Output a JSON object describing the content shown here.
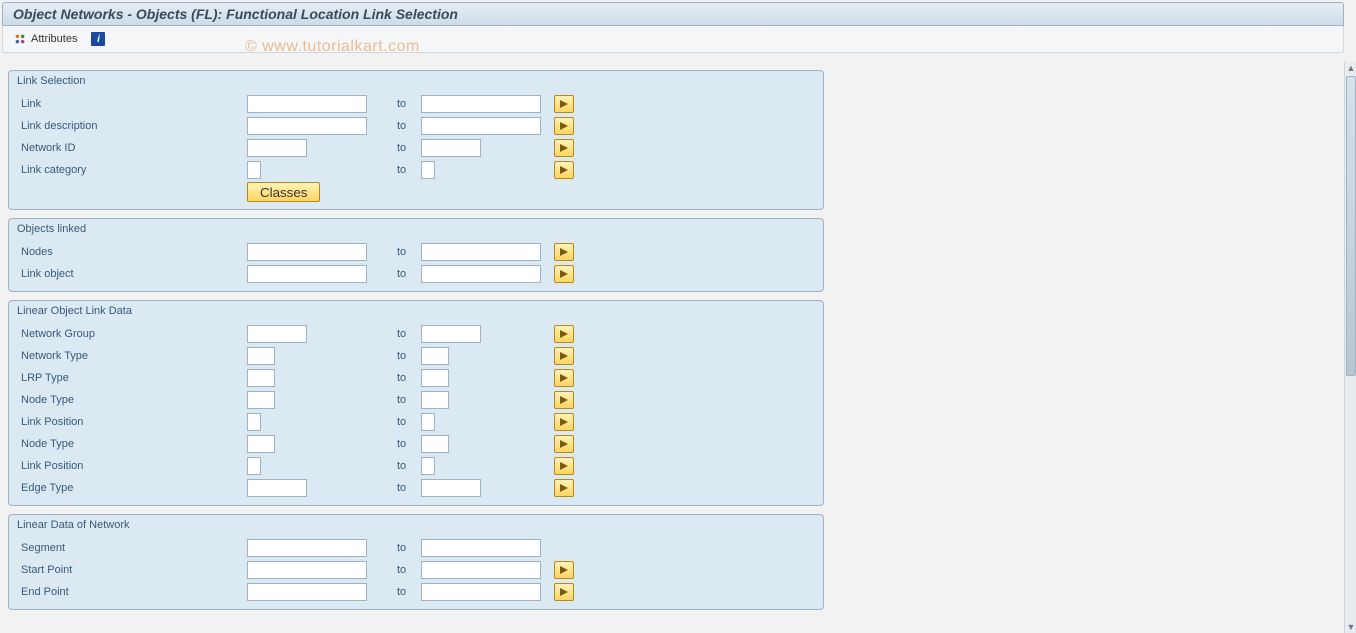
{
  "title": "Object Networks - Objects (FL): Functional Location Link Selection",
  "watermark": "© www.tutorialkart.com",
  "toolbar": {
    "attributes_label": "Attributes"
  },
  "common": {
    "to": "to"
  },
  "buttons": {
    "classes": "Classes"
  },
  "groups": {
    "link_selection": {
      "title": "Link Selection",
      "rows": {
        "link": {
          "label": "Link",
          "from_w": "w-lg",
          "to_w": "w-lg",
          "multi": true,
          "from": "",
          "to": ""
        },
        "link_desc": {
          "label": "Link description",
          "from_w": "w-lg",
          "to_w": "w-lg",
          "multi": true,
          "from": "",
          "to": ""
        },
        "network_id": {
          "label": "Network ID",
          "from_w": "w-md",
          "to_w": "w-md",
          "multi": true,
          "from": "",
          "to": ""
        },
        "link_category": {
          "label": "Link category",
          "from_w": "w-xs",
          "to_w": "w-xs",
          "multi": true,
          "from": "",
          "to": ""
        }
      }
    },
    "objects_linked": {
      "title": "Objects linked",
      "rows": {
        "nodes": {
          "label": "Nodes",
          "from_w": "w-lg",
          "to_w": "w-lg",
          "multi": true,
          "from": "",
          "to": ""
        },
        "link_object": {
          "label": "Link object",
          "from_w": "w-lg",
          "to_w": "w-lg",
          "multi": true,
          "from": "",
          "to": ""
        }
      }
    },
    "lold": {
      "title": "Linear Object Link Data",
      "rows": {
        "network_group": {
          "label": "Network Group",
          "from_w": "w-md",
          "to_w": "w-md",
          "multi": true,
          "from": "",
          "to": ""
        },
        "network_type": {
          "label": "Network Type",
          "from_w": "w-sm",
          "to_w": "w-sm",
          "multi": true,
          "from": "",
          "to": ""
        },
        "lrp_type": {
          "label": "LRP Type",
          "from_w": "w-sm",
          "to_w": "w-sm",
          "multi": true,
          "from": "",
          "to": ""
        },
        "node_type": {
          "label": "Node Type",
          "from_w": "w-sm",
          "to_w": "w-sm",
          "multi": true,
          "from": "",
          "to": ""
        },
        "link_position": {
          "label": "Link Position",
          "from_w": "w-xs",
          "to_w": "w-xs",
          "multi": true,
          "from": "",
          "to": ""
        },
        "node_type2": {
          "label": "Node Type",
          "from_w": "w-sm",
          "to_w": "w-sm",
          "multi": true,
          "from": "",
          "to": ""
        },
        "link_position2": {
          "label": "Link Position",
          "from_w": "w-xs",
          "to_w": "w-xs",
          "multi": true,
          "from": "",
          "to": ""
        },
        "edge_type": {
          "label": "Edge Type",
          "from_w": "w-md",
          "to_w": "w-md",
          "multi": true,
          "from": "",
          "to": ""
        }
      }
    },
    "ldon": {
      "title": "Linear Data of Network",
      "rows": {
        "segment": {
          "label": "Segment",
          "from_w": "w-lg",
          "to_w": "w-lg",
          "multi": false,
          "from": "",
          "to": ""
        },
        "start_point": {
          "label": "Start Point",
          "from_w": "w-lg",
          "to_w": "w-lg",
          "multi": true,
          "from": "",
          "to": ""
        },
        "end_point": {
          "label": "End Point",
          "from_w": "w-lg",
          "to_w": "w-lg",
          "multi": true,
          "from": "",
          "to": ""
        }
      }
    }
  }
}
